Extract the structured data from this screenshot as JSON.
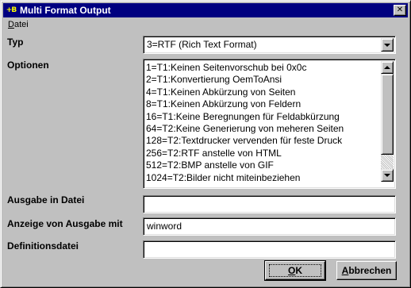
{
  "window": {
    "title": "Multi Format Output",
    "icon_text": "+B",
    "close_glyph": "✕"
  },
  "menu": {
    "items": [
      {
        "label_acc": "D",
        "label_rest": "atei"
      }
    ]
  },
  "form": {
    "typ_label": "Typ",
    "typ_value": "3=RTF (Rich Text Format)",
    "optionen_label": "Optionen",
    "optionen_items": [
      "1=T1:Keinen Seitenvorschub bei 0x0c",
      "2=T1:Konvertierung OemToAnsi",
      "4=T1:Keinen Abkürzung von Seiten",
      "8=T1:Keinen Abkürzung von Feldern",
      "16=T1:Keine Beregnungen für Feldabkürzung",
      "64=T2:Keine Generierung von meheren Seiten",
      "128=T2:Textdrucker vervenden für feste Druck",
      "256=T2:RTF anstelle von HTML",
      "512=T2:BMP anstelle von GIF",
      "1024=T2:Bilder nicht miteinbeziehen"
    ],
    "ausgabe_label": "Ausgabe in Datei",
    "ausgabe_value": "",
    "anzeige_label": "Anzeige von Ausgabe mit",
    "anzeige_value": "winword",
    "definition_label": "Definitionsdatei",
    "definition_value": ""
  },
  "buttons": {
    "ok_acc": "O",
    "ok_rest": "K",
    "cancel_acc": "A",
    "cancel_rest": "bbrechen"
  },
  "colors": {
    "titlebar": "#000080",
    "face": "#c0c0c0"
  }
}
